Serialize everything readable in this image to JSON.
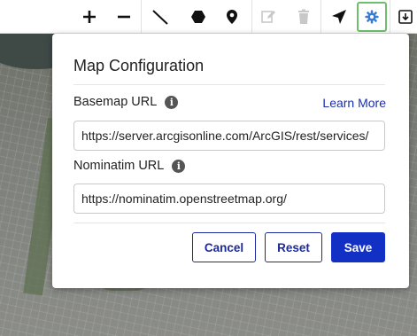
{
  "toolbar": {
    "items": [
      {
        "name": "zoom-in",
        "glyph": "+"
      },
      {
        "name": "zoom-out",
        "glyph": "−"
      },
      {
        "name": "draw-line",
        "icon": "line-icon"
      },
      {
        "name": "draw-polygon",
        "icon": "hexagon-icon"
      },
      {
        "name": "draw-point",
        "icon": "map-pin-icon"
      },
      {
        "name": "edit",
        "icon": "edit-icon",
        "disabled": true
      },
      {
        "name": "delete",
        "icon": "trash-icon",
        "disabled": true
      },
      {
        "name": "locate",
        "icon": "navigation-arrow-icon"
      },
      {
        "name": "settings",
        "icon": "gear-icon",
        "active": true
      },
      {
        "name": "download",
        "icon": "download-icon"
      }
    ],
    "active_color": "#6cbf6c"
  },
  "dialog": {
    "title": "Map Configuration",
    "basemap": {
      "label": "Basemap URL",
      "learn_more": "Learn More",
      "value": "https://server.arcgisonline.com/ArcGIS/rest/services/"
    },
    "nominatim": {
      "label": "Nominatim URL",
      "value": "https://nominatim.openstreetmap.org/"
    },
    "buttons": {
      "cancel": "Cancel",
      "reset": "Reset",
      "save": "Save"
    },
    "info_glyph": "i",
    "primary_color": "#1230c4",
    "link_color": "#1a2fb0"
  }
}
